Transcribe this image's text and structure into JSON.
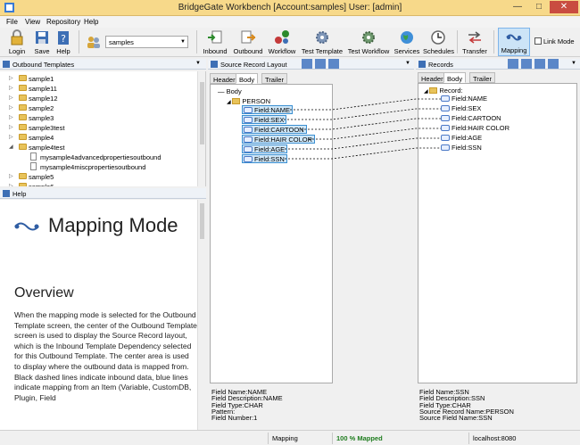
{
  "window": {
    "title": "BridgeGate Workbench [Account:samples] User: [admin]"
  },
  "menu": [
    "File",
    "View",
    "Repository",
    "Help"
  ],
  "toolbar": {
    "login": "Login",
    "save": "Save",
    "help": "Help",
    "account_value": "samples",
    "inbound": "Inbound",
    "outbound": "Outbound",
    "workflow": "Workflow",
    "test_template": "Test Template",
    "test_workflow": "Test Workflow",
    "services": "Services",
    "schedules": "Schedules",
    "transfer": "Transfer",
    "mapping": "Mapping",
    "link_mode": "Link Mode"
  },
  "outbound_templates": {
    "title": "Outbound Templates",
    "items": [
      "sample1",
      "sample11",
      "sample12",
      "sample2",
      "sample3",
      "sample3test",
      "sample4",
      "sample4test",
      "mysample4advancedpropertiesoutbound",
      "mysample4miscpropertiesoutbound",
      "sample5",
      "sample6"
    ]
  },
  "help": {
    "title": "Help",
    "heading": "Mapping Mode",
    "subheading": "Overview",
    "text": "When the mapping mode is selected for the Outbound Template screen, the center of the Outbound Template screen is used to display the Source Record layout, which is the Inbound Template Dependency selected for this Outbound Template. The center area is used to display where the outbound data is mapped from. Black dashed lines indicate inbound data, blue lines indicate mapping from an Item (Variable, CustomDB, Plugin, Field"
  },
  "source_layout": {
    "title": "Source Record Layout",
    "tabs": [
      "Header",
      "Body",
      "Trailer"
    ],
    "root": "Body",
    "group": "PERSON",
    "fields": [
      "Field:NAME",
      "Field:SEX",
      "Field:CARTOON",
      "Field:HAIR COLOR",
      "Field:AGE",
      "Field:SSN"
    ],
    "info": [
      "Field Name:NAME",
      "Field Description:NAME",
      "Field Type:CHAR",
      "Pattern:",
      "Field Number:1"
    ]
  },
  "records": {
    "title": "Records",
    "tabs": [
      "Header",
      "Body",
      "Trailer"
    ],
    "root": "Record:",
    "fields": [
      "Field:NAME",
      "Field:SEX",
      "Field:CARTOON",
      "Field:HAIR COLOR",
      "Field:AGE",
      "Field:SSN"
    ],
    "info": [
      "Field Name:SSN",
      "Field Description:SSN",
      "Field Type:CHAR",
      "Source Record Name:PERSON",
      "Source Field Name:SSN"
    ]
  },
  "status": {
    "mode": "Mapping",
    "mapped": "100 %  Mapped",
    "server": "localhost:8080"
  },
  "colors": {
    "titlebar": "#f7d98a",
    "selection": "#cfe7f8",
    "mapped": "#1e7c1e",
    "close": "#c94c40"
  }
}
